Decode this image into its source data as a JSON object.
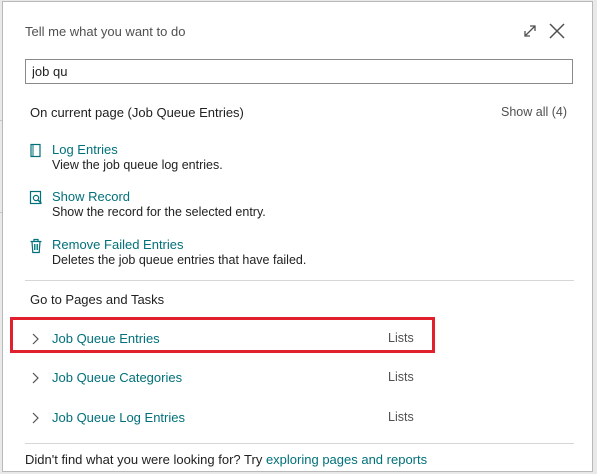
{
  "dialog": {
    "title": "Tell me what you want to do",
    "expand_icon": "expand-icon",
    "close_icon": "close-icon"
  },
  "search": {
    "value": "job qu"
  },
  "current_page": {
    "title": "On current page (Job Queue Entries)",
    "show_all": "Show all (4)",
    "actions": [
      {
        "icon": "document-icon",
        "name": "Log Entries",
        "desc": "View the job queue log entries."
      },
      {
        "icon": "search-record-icon",
        "name": "Show Record",
        "desc": "Show the record for the selected entry."
      },
      {
        "icon": "trash-icon",
        "name": "Remove Failed Entries",
        "desc": "Deletes the job queue entries that have failed."
      }
    ]
  },
  "pages_tasks": {
    "title": "Go to Pages and Tasks",
    "items": [
      {
        "label": "Job Queue Entries",
        "category": "Lists"
      },
      {
        "label": "Job Queue Categories",
        "category": "Lists"
      },
      {
        "label": "Job Queue Log Entries",
        "category": "Lists"
      }
    ]
  },
  "footer": {
    "text": "Didn't find what you were looking for? Try",
    "link": "exploring pages and reports"
  },
  "colors": {
    "link": "#00707a",
    "highlight": "#e0202c"
  }
}
